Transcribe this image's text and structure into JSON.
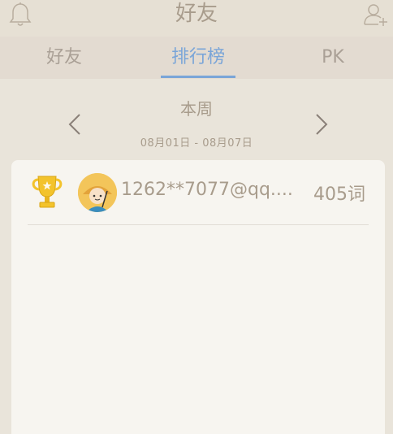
{
  "header": {
    "title": "好友",
    "bell_icon": "bell-icon",
    "add_friend_icon": "add-user-icon"
  },
  "tabs": [
    {
      "label": "好友",
      "active": false
    },
    {
      "label": "排行榜",
      "active": true
    },
    {
      "label": "PK",
      "active": false
    }
  ],
  "period": {
    "label": "本周",
    "range": "08月01日 - 08月07日",
    "prev_icon": "chevron-left-icon",
    "next_icon": "chevron-right-icon"
  },
  "leaderboard": {
    "entries": [
      {
        "rank_icon": "trophy-icon",
        "username": "1262**7077@qq....",
        "score": "405词"
      }
    ]
  },
  "colors": {
    "accent": "#7aa5d8",
    "text": "#a89c8c",
    "background": "#e9e4da",
    "card": "#f7f5f0"
  }
}
